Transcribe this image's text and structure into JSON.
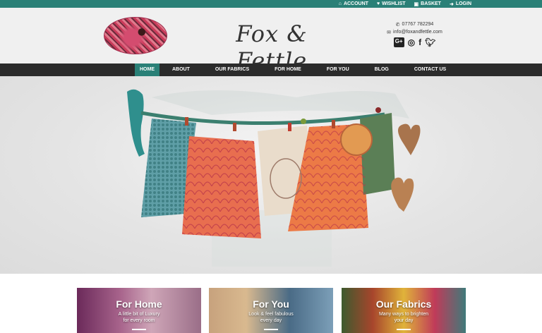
{
  "topbar": {
    "links": [
      {
        "icon": "home-icon",
        "glyph": "⌂",
        "label": "ACCOUNT"
      },
      {
        "icon": "heart-icon",
        "glyph": "♥",
        "label": "WISHLIST"
      },
      {
        "icon": "basket-icon",
        "glyph": "🛒",
        "label": "BASKET"
      },
      {
        "icon": "login-icon",
        "glyph": "➜",
        "label": "LOGIN"
      }
    ]
  },
  "header": {
    "brand": "Fox & Fettle",
    "phone": "07767 782294",
    "email": "info@foxandfettle.com",
    "socials": [
      "G+",
      "instagram",
      "facebook",
      "twitter"
    ]
  },
  "nav": {
    "items": [
      "HOME",
      "ABOUT",
      "OUR FABRICS",
      "FOR HOME",
      "FOR YOU",
      "BLOG",
      "CONTACT US"
    ]
  },
  "cards": [
    {
      "title": "For Home",
      "subtitle_line1": "A little bit of Luxury",
      "subtitle_line2": "for every room"
    },
    {
      "title": "For You",
      "subtitle_line1": "Look & feel fabulous",
      "subtitle_line2": "every day"
    },
    {
      "title": "Our Fabrics",
      "subtitle_line1": "Many ways to brighten",
      "subtitle_line2": "your day"
    }
  ],
  "colors": {
    "accent": "#2a8077",
    "nav_bg": "#2b2b2b",
    "header_bg": "#f0f0f0"
  }
}
